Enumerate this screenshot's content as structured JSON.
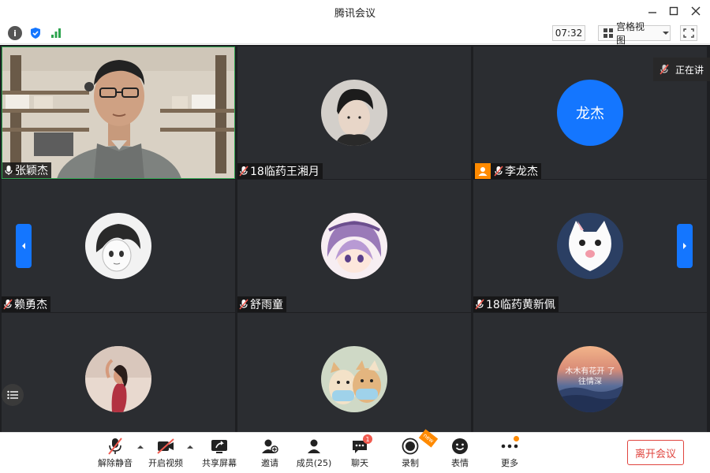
{
  "window": {
    "title": "腾讯会议",
    "controls": [
      "minimize",
      "maximize",
      "close"
    ]
  },
  "toolbar": {
    "timer": "07:32",
    "view_label": "宫格视图",
    "icons": [
      "info-icon",
      "shield-icon",
      "signal-icon",
      "grid-icon",
      "chevron-down-icon",
      "fullscreen-icon"
    ]
  },
  "speaking_indicator": "正在讲",
  "participants": [
    {
      "name": "张颖杰",
      "type": "video",
      "muted": false,
      "host": false,
      "active": true
    },
    {
      "name": "18临药王湘月",
      "type": "avatar",
      "muted": true,
      "host": false
    },
    {
      "name": "李龙杰",
      "type": "avatar-text",
      "avatar_text": "龙杰",
      "avatar_color": "#1476ff",
      "muted": true,
      "host": true
    },
    {
      "name": "赖勇杰",
      "type": "avatar",
      "muted": true,
      "host": false
    },
    {
      "name": "舒雨童",
      "type": "avatar",
      "muted": true,
      "host": false
    },
    {
      "name": "18临药黄新佩",
      "type": "avatar",
      "muted": true,
      "host": false
    },
    {
      "name": "",
      "type": "avatar",
      "muted": true,
      "host": false
    },
    {
      "name": "",
      "type": "avatar",
      "muted": true,
      "host": false
    },
    {
      "name": "",
      "type": "avatar",
      "muted": true,
      "host": false
    }
  ],
  "avatar_art": {
    "sunset_text": "木木有花开 了往情深"
  },
  "bottombar": {
    "unmute": "解除静音",
    "start_video": "开启视频",
    "share_screen": "共享屏幕",
    "invite": "邀请",
    "members": "成员(25)",
    "chat": "聊天",
    "chat_badge": "1",
    "record": "录制",
    "record_ribbon": "new",
    "reactions": "表情",
    "more": "更多",
    "leave": "离开会议"
  },
  "colors": {
    "accent": "#1476ff",
    "leave": "#e0453f",
    "host": "#ff8a00",
    "active_border": "#2ea44f",
    "tile_bg": "#2b2d31"
  }
}
